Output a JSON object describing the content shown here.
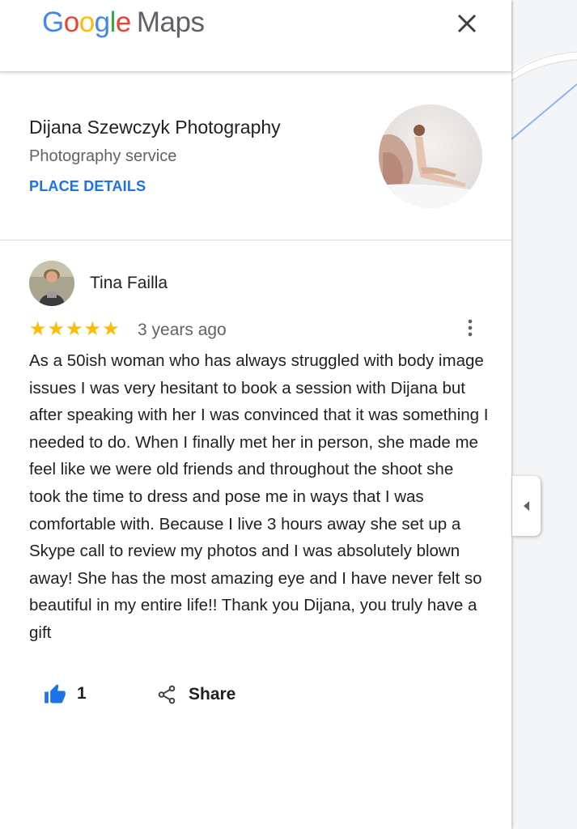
{
  "header": {
    "logo_letters": [
      "G",
      "o",
      "o",
      "g",
      "l",
      "e"
    ],
    "logo_maps": "Maps",
    "close_icon": "close-icon"
  },
  "place": {
    "name": "Dijana Szewczyk Photography",
    "category": "Photography service",
    "details_link": "PLACE DETAILS"
  },
  "review": {
    "reviewer": "Tina Failla",
    "stars": "★★★★★",
    "rating": 5,
    "date": "3 years ago",
    "text": "As a 50ish woman who has always struggled with body image issues I was very hesitant to book a session with Dijana but after speaking with her I was convinced that it was something I needed to do. When I finally met her in person, she made me feel like we were old friends and throughout the shoot she took the time to dress and pose me in ways that I was  comfortable with. Because I live 3 hours away she set up a Skype call to review my photos and I was absolutely blown away! She has the most amazing eye and I have never felt so beautiful in my entire life!! Thank you Dijana, you truly have a gift",
    "like_count": "1",
    "share_label": "Share"
  },
  "icons": {
    "close": "close-icon",
    "more": "more-vert-icon",
    "like": "thumb-up-icon",
    "share": "share-icon",
    "collapse": "caret-left-icon"
  },
  "colors": {
    "accent_blue": "#1a73e8",
    "star_yellow": "#fbbc04",
    "text_primary": "#202124",
    "text_secondary": "#5f6368"
  }
}
